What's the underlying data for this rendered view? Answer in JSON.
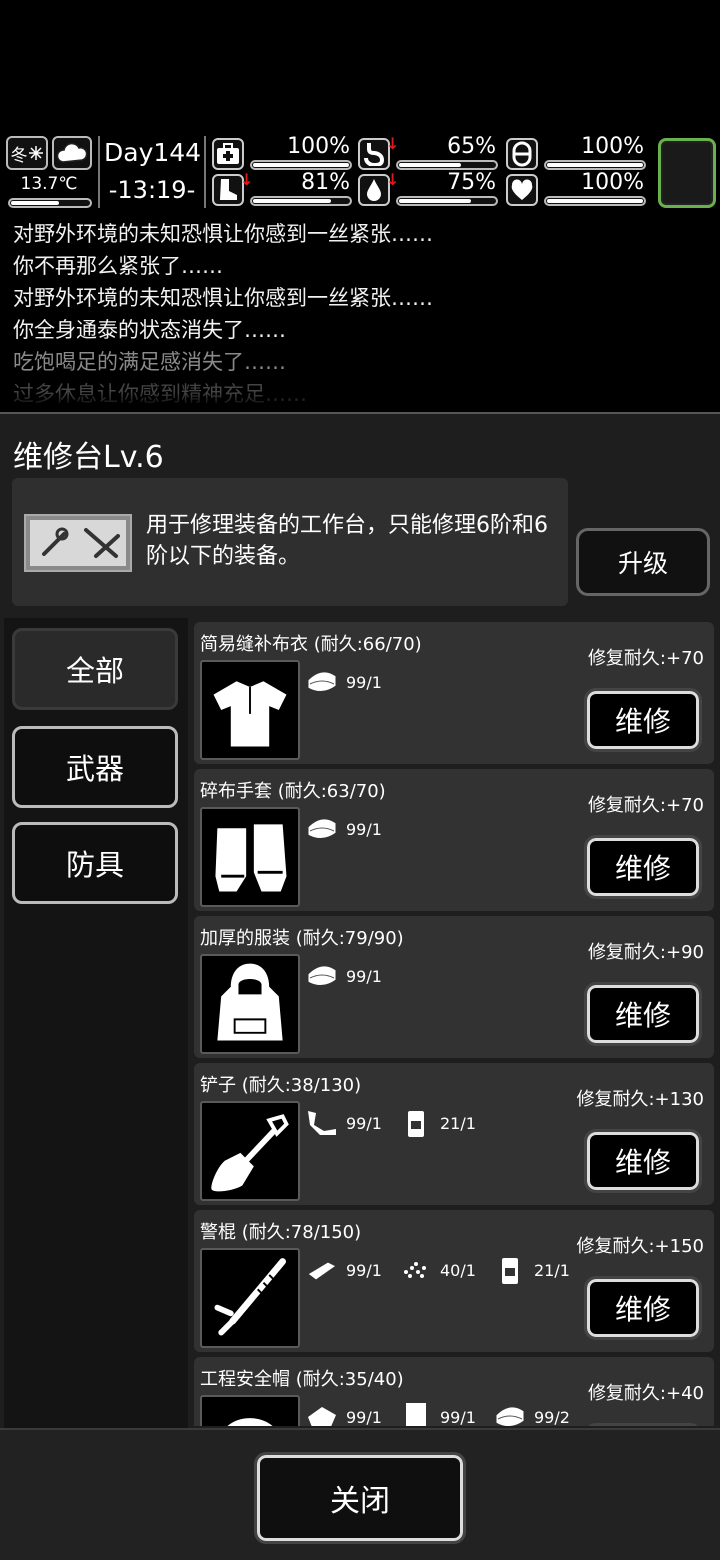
{
  "hud": {
    "season": "冬",
    "temperature": "13.7℃",
    "temperature_level": 0.62,
    "day": "Day144",
    "time": "-13:19-",
    "stats": [
      {
        "icon": "medkit-icon",
        "value": "100%",
        "level": 1.0,
        "falling": false
      },
      {
        "icon": "stomach-icon",
        "value": "65%",
        "level": 0.65,
        "falling": true
      },
      {
        "icon": "pill-icon",
        "value": "100%",
        "level": 1.0,
        "falling": false
      },
      {
        "icon": "boot-icon",
        "value": "81%",
        "level": 0.81,
        "falling": true
      },
      {
        "icon": "water-drop-icon",
        "value": "75%",
        "level": 0.75,
        "falling": true
      },
      {
        "icon": "heart-icon",
        "value": "100%",
        "level": 1.0,
        "falling": false
      }
    ]
  },
  "log": [
    "对野外环境的未知恐惧让你感到一丝紧张……",
    "你不再那么紧张了……",
    "对野外环境的未知恐惧让你感到一丝紧张……",
    "你全身通泰的状态消失了……",
    "吃饱喝足的满足感消失了……",
    "过多休息让你感到精神充足……"
  ],
  "panel": {
    "title": "维修台Lv.6",
    "description": "用于修理装备的工作台，只能修理6阶和6阶以下的装备。",
    "upgrade_label": "升级",
    "tabs": [
      "全部",
      "武器",
      "防具"
    ],
    "repair_label": "维修",
    "close_label": "关闭",
    "items": [
      {
        "name": "简易缝补布衣 (耐久:66/70)",
        "repair": "修复耐久:+70",
        "icon": "shirt-icon",
        "materials": [
          {
            "icon": "cloth-icon",
            "count": "99/1"
          }
        ]
      },
      {
        "name": "碎布手套 (耐久:63/70)",
        "repair": "修复耐久:+70",
        "icon": "gloves-icon",
        "materials": [
          {
            "icon": "cloth-icon",
            "count": "99/1"
          }
        ]
      },
      {
        "name": "加厚的服装 (耐久:79/90)",
        "repair": "修复耐久:+90",
        "icon": "hoodie-icon",
        "materials": [
          {
            "icon": "cloth-icon",
            "count": "99/1"
          }
        ]
      },
      {
        "name": "铲子 (耐久:38/130)",
        "repair": "修复耐久:+130",
        "icon": "shovel-icon",
        "materials": [
          {
            "icon": "pipe-icon",
            "count": "99/1"
          },
          {
            "icon": "oil-can-icon",
            "count": "21/1"
          }
        ]
      },
      {
        "name": "警棍 (耐久:78/150)",
        "repair": "修复耐久:+150",
        "icon": "baton-icon",
        "materials": [
          {
            "icon": "whetstone-icon",
            "count": "99/1"
          },
          {
            "icon": "scrap-icon",
            "count": "40/1"
          },
          {
            "icon": "oil-can-icon",
            "count": "21/1"
          }
        ]
      },
      {
        "name": "工程安全帽 (耐久:35/40)",
        "repair": "修复耐久:+40",
        "icon": "helmet-icon",
        "materials": [
          {
            "icon": "leather-icon",
            "count": "99/1"
          },
          {
            "icon": "fabric-icon",
            "count": "99/1"
          },
          {
            "icon": "cloth-icon",
            "count": "99/2"
          }
        ]
      }
    ]
  }
}
